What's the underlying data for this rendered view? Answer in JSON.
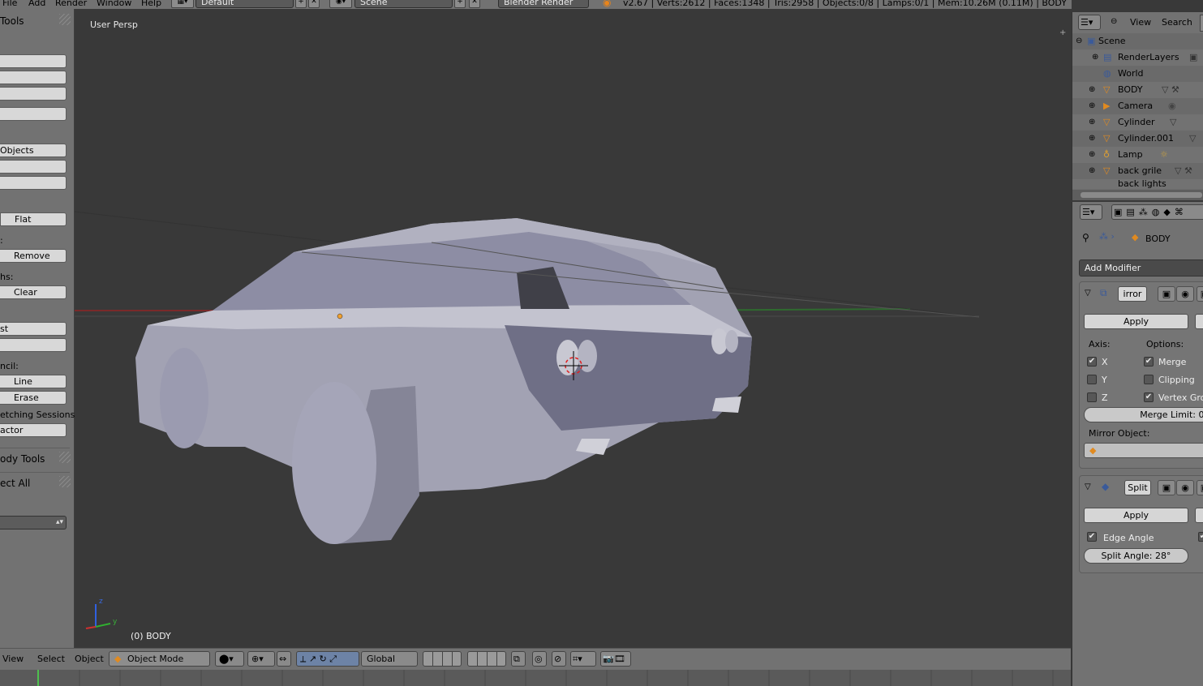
{
  "menubar": {
    "items": [
      "File",
      "Add",
      "Render",
      "Window",
      "Help"
    ],
    "layout_field": "Default",
    "scene_field": "Scene",
    "engine": "Blender Render",
    "stats": "v2.67 | Verts:2612 | Faces:1348 | Tris:2958 | Objects:0/8 | Lamps:0/1 | Mem:10.26M (0.11M) | BODY"
  },
  "toolshelf": {
    "title": "Tools",
    "objects_label": "Objects",
    "shading_flat": "Flat",
    "remove_label": "Remove",
    "paths_label": "hs:",
    "clear_label": "Clear",
    "st_label": "st",
    "pencil_label": "ncil:",
    "line_label": "Line",
    "erase_label": "Erase",
    "sketching_label": "etching Sessions",
    "actor_label": "actor",
    "rigid_body_tools": "ody Tools",
    "select_all": "ect All",
    "colon_label": ":"
  },
  "viewport": {
    "view_label": "User Persp",
    "object_label": "(0) BODY",
    "axis_z": "z",
    "axis_y": "y"
  },
  "header": {
    "view": "View",
    "select": "Select",
    "object": "Object",
    "mode": "Object Mode",
    "orientation": "Global"
  },
  "outliner": {
    "view": "View",
    "search": "Search",
    "items": [
      "Scene",
      "RenderLayers",
      "World",
      "BODY",
      "Camera",
      "Cylinder",
      "Cylinder.001",
      "Lamp",
      "back grile",
      "back lights"
    ]
  },
  "properties": {
    "object_name": "BODY",
    "add_modifier": "Add Modifier",
    "mirror": {
      "name": "irror",
      "apply": "Apply",
      "axis_label": "Axis:",
      "options_label": "Options:",
      "x": "X",
      "y": "Y",
      "z": "Z",
      "merge": "Merge",
      "clipping": "Clipping",
      "vertex_groups": "Vertex Gro",
      "merge_limit": "Merge Limit: 0.",
      "mirror_object": "Mirror Object:",
      "x_checked": true,
      "y_checked": false,
      "z_checked": false,
      "merge_checked": true,
      "clipping_checked": false,
      "vertex_checked": true
    },
    "split": {
      "name": "Split",
      "apply": "Apply",
      "edge_angle": "Edge Angle",
      "split_angle": "Split Angle: 28°"
    }
  },
  "colors": {
    "panel": "#727272",
    "viewport": "#393939",
    "button": "#d8d8d8",
    "car": "#a9a9bd"
  }
}
